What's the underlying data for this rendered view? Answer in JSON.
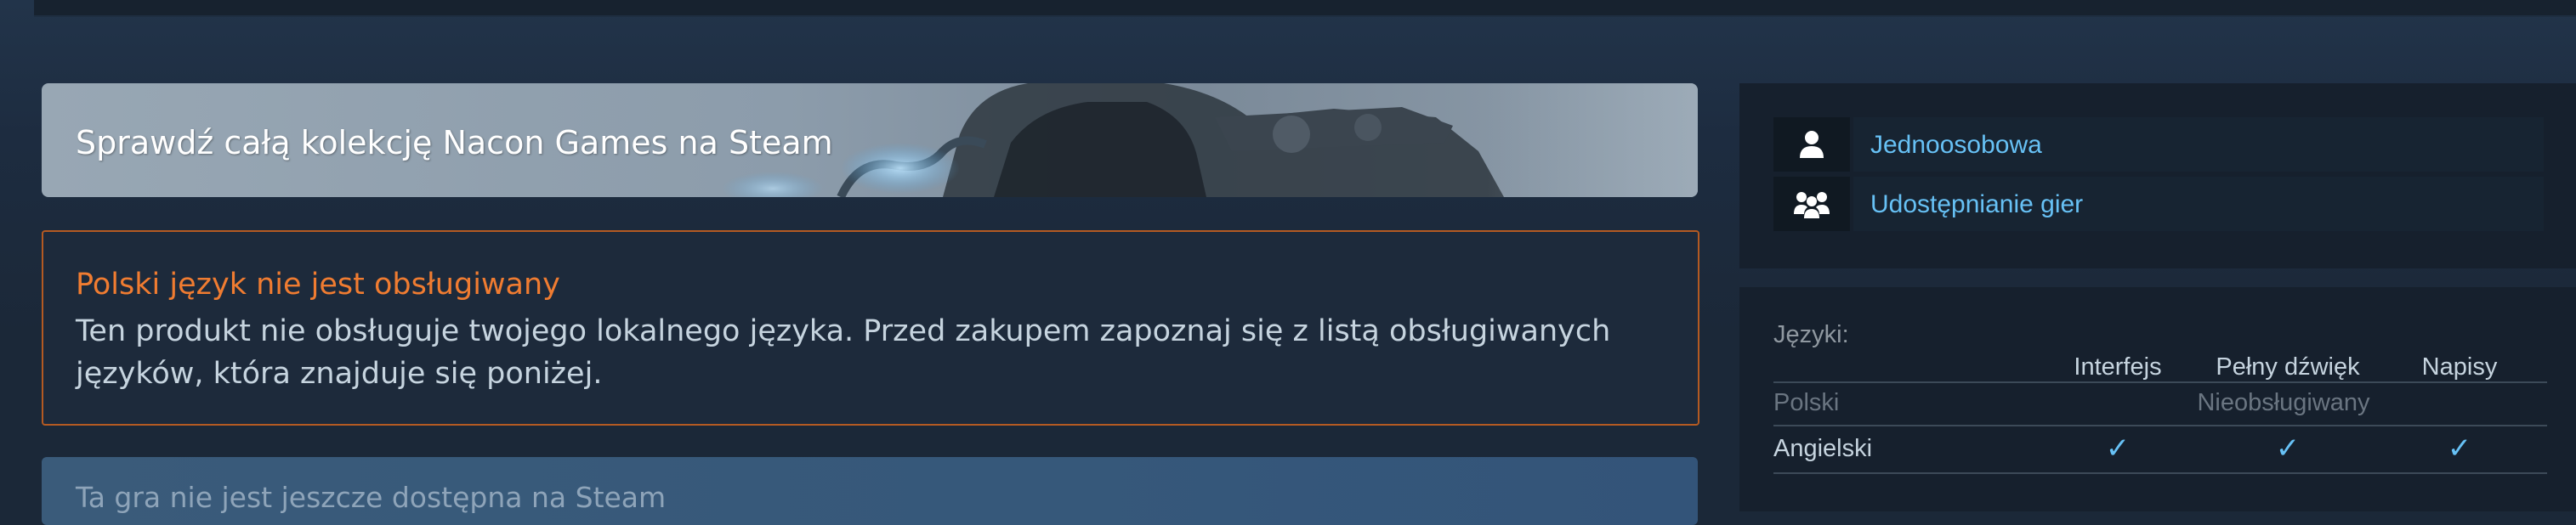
{
  "banner": {
    "title": "Sprawdź całą kolekcję Nacon Games na Steam"
  },
  "language_notice": {
    "title": "Polski język nie jest obsługiwany",
    "text": "Ten produkt nie obsługuje twojego lokalnego języka. Przed zakupem zapoznaj się z listą obsługiwanych języków, która znajduje się poniżej."
  },
  "unavailable": {
    "text": "Ta gra nie jest jeszcze dostępna na Steam"
  },
  "features": [
    {
      "icon": "single-player-icon",
      "label": "Jednoosobowa"
    },
    {
      "icon": "family-sharing-icon",
      "label": "Udostępnianie gier"
    }
  ],
  "languages": {
    "heading": "Języki:",
    "columns": [
      "Interfejs",
      "Pełny dźwięk",
      "Napisy"
    ],
    "rows": [
      {
        "name": "Polski",
        "unsupported_label": "Nieobsługiwany",
        "supported": false
      },
      {
        "name": "Angielski",
        "interface": "✓",
        "audio": "✓",
        "subtitles": "✓",
        "supported": true
      }
    ]
  },
  "colors": {
    "page_bg": "#1b2838",
    "link_blue": "#67c1f5",
    "notice_orange": "#f07c31",
    "notice_border": "#b45a22",
    "body_text": "#c6d4df",
    "muted_text": "#8f98a0"
  }
}
